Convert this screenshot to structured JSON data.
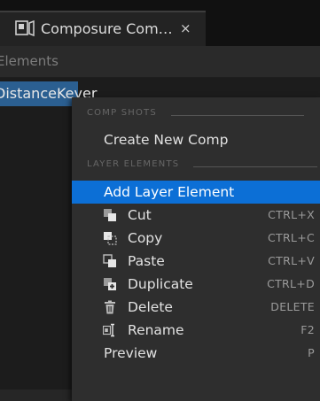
{
  "tab": {
    "title": "Composure Com…",
    "close": "×",
    "icon": "composure-icon"
  },
  "subheader": {
    "label": "Elements"
  },
  "list": {
    "selected_item": "DistanceKeyer"
  },
  "menu": {
    "sections": [
      {
        "id": "comp_shots",
        "header": "COMP SHOTS"
      },
      {
        "id": "layer_elements",
        "header": "LAYER ELEMENTS"
      }
    ],
    "create_new_comp": "Create New Comp",
    "add_layer_element": "Add Layer Element",
    "items": [
      {
        "label": "Cut",
        "shortcut": "CTRL+X",
        "icon": "cut-icon"
      },
      {
        "label": "Copy",
        "shortcut": "CTRL+C",
        "icon": "copy-icon"
      },
      {
        "label": "Paste",
        "shortcut": "CTRL+V",
        "icon": "paste-icon"
      },
      {
        "label": "Duplicate",
        "shortcut": "CTRL+D",
        "icon": "duplicate-icon"
      },
      {
        "label": "Delete",
        "shortcut": "DELETE",
        "icon": "trash-icon"
      },
      {
        "label": "Rename",
        "shortcut": "F2",
        "icon": "rename-icon"
      }
    ],
    "preview": {
      "label": "Preview",
      "shortcut": "P"
    }
  },
  "colors": {
    "highlight": "#0c6fd6",
    "selection": "#2b5f91",
    "menu_bg": "#2e2e2e"
  }
}
